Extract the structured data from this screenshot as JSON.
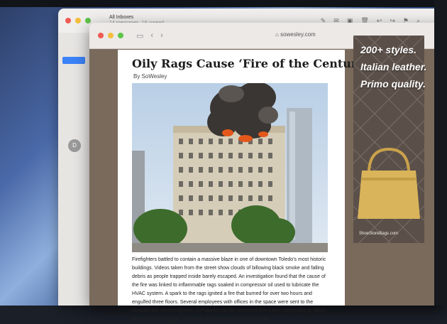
{
  "mail": {
    "title": "All Inboxes",
    "subtitle": "14 messages, 18 unread"
  },
  "browser": {
    "url": "sowesley.com",
    "back": "‹",
    "forward": "›"
  },
  "article": {
    "headline": "Oily Rags Cause ‘Fire of the Century’",
    "byline": "By SoWesley",
    "body": "Firefighters battled to contain a massive blaze in one of downtown Toledo’s most historic buildings. Videos taken from the street show clouds of billowing black smoke and falling debris as people trapped inside barely escaped. An investigation found that the cause of the fire was linked to inflammable rags soaked in compressor oil used to lubricate the HVAC system. A spark to the rags ignited a fire that burned for over two hours and engulfed three floors. Several employees with offices in the space were sent to the hospital with severe injuries. Companies on the scorched floors are suspending in office operations during the ... to break their contract without penalty"
  },
  "ad": {
    "line1": "200+ styles.",
    "line2": "Italian leather.",
    "line3": "Primo quality.",
    "url": "ShoeStoreBags.com"
  },
  "colors": {
    "desktop": "#4a69a8",
    "ad_bg": "#5b5049",
    "bag": "#d9b45a",
    "fire": "#e4571a"
  }
}
